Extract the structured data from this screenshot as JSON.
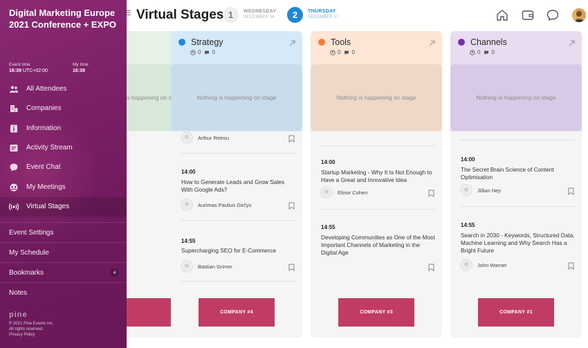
{
  "header": {
    "title": "Virtual Stages",
    "days": [
      {
        "number": "1",
        "name": "WEDNESDAY",
        "date": "DECEMBER 16"
      },
      {
        "number": "2",
        "name": "THURSDAY",
        "date": "DECEMBER 17"
      }
    ],
    "icons": [
      "home-icon",
      "wallet-icon",
      "chat-icon",
      "user-avatar"
    ]
  },
  "sidebar": {
    "event_title": "Digital Marketing Europe 2021 Conference + EXPO",
    "event_time_label": "Event time",
    "event_time_value": "16:39",
    "event_time_tz": "UTC+02:00",
    "my_time_label": "My time",
    "my_time_value": "16:39",
    "nav": [
      {
        "label": "All Attendees",
        "icon": "people-icon"
      },
      {
        "label": "Companies",
        "icon": "buildings-icon"
      },
      {
        "label": "Information",
        "icon": "info-icon"
      },
      {
        "label": "Activity Stream",
        "icon": "stream-icon"
      },
      {
        "label": "Event Chat",
        "icon": "chat-icon"
      },
      {
        "label": "My Meetings",
        "icon": "meetings-icon"
      },
      {
        "label": "Virtual Stages",
        "icon": "broadcast-icon"
      }
    ],
    "sections": [
      {
        "label": "Event Settings"
      },
      {
        "label": "My Schedule"
      },
      {
        "label": "Bookmarks",
        "badge": "4"
      },
      {
        "label": "Notes"
      }
    ],
    "logo": "pine",
    "copyright_lines": [
      "© 2021 Pine Events Inc.",
      "All rights reserved.",
      "Privacy Policy"
    ]
  },
  "stages": [
    {
      "name": "",
      "color": "#4caf50",
      "header_bg": "#e6f2e6",
      "stage_bg": "#d8e8d8",
      "stage_text": "Nothing is happening on stage",
      "company": ""
    },
    {
      "name": "Strategy",
      "color": "#1e88e5",
      "header_bg": "#d6e9f8",
      "stage_bg": "#c8dcec",
      "views": "0",
      "comments": "0",
      "stage_text": "Nothing is happening on stage",
      "top_speaker": "Arthur Retrou",
      "sessions": [
        {
          "time": "14:00",
          "title": "How to Generate Leads and Grow Sales With Google Ads?",
          "speaker": "Aurimas Paulius Girčys"
        },
        {
          "time": "14:55",
          "title": "Supercharging SEO for E-Commerce",
          "speaker": "Bastian Grimm"
        }
      ],
      "company": "COMPANY #4"
    },
    {
      "name": "Tools",
      "color": "#f57c32",
      "header_bg": "#fde6d6",
      "stage_bg": "#eed8c8",
      "views": "0",
      "comments": "0",
      "stage_text": "Nothing is happening on stage",
      "sessions": [
        {
          "time": "14:00",
          "title": "Startup Marketing - Why It Is Not Enough to Have a Great and Innovative Idea",
          "speaker": "Elinor Cohen"
        },
        {
          "time": "14:55",
          "title": "Developing Communities as One of the Most Important Channels of Marketing in the Digital Age",
          "speaker": ""
        }
      ],
      "company": "COMPANY #3"
    },
    {
      "name": "Channels",
      "color": "#7b2fa8",
      "header_bg": "#e8dcf0",
      "stage_bg": "#d8cae6",
      "views": "0",
      "comments": "0",
      "stage_text": "Nothing is happening on stage",
      "sessions": [
        {
          "time": "14:00",
          "title": "The Secret Brain Science of Content Optimisation",
          "speaker": "Jillian Ney"
        },
        {
          "time": "14:55",
          "title": "Search in 2030 - Keywords, Structured Data, Machine Learning and Why Search Has a Bright Future",
          "speaker": "John Warner"
        }
      ],
      "company": "COMPANY #1"
    }
  ]
}
